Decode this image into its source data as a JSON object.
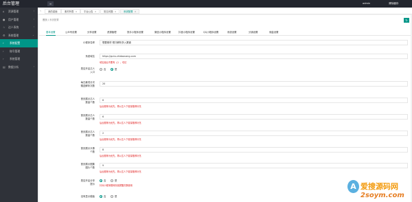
{
  "app": {
    "title": "后台管理",
    "menu_toggle": "≡"
  },
  "header": {
    "admin": "admin",
    "logout": "清除缓存"
  },
  "sidebar": {
    "items": [
      {
        "label": "资源管理",
        "icon": "home-icon"
      },
      {
        "label": "用户管理",
        "icon": "user-icon"
      },
      {
        "label": "达人系统",
        "icon": "star-icon"
      },
      {
        "label": "系统管理",
        "icon": "gear-icon"
      },
      {
        "label": "系统配置",
        "icon": "config-icon"
      },
      {
        "label": "账号管理",
        "icon": "list-icon"
      },
      {
        "label": "系统管理",
        "icon": "list-icon"
      },
      {
        "label": "数据分析",
        "icon": "chart-icon"
      }
    ]
  },
  "tabs": [
    {
      "label": "我的桌面"
    },
    {
      "label": "素材列表"
    },
    {
      "label": "平台公告"
    },
    {
      "label": "常见问题"
    },
    {
      "label": "系统配置"
    }
  ],
  "breadcrumb": {
    "home": "首页",
    "sep": "/",
    "current": "系统配置"
  },
  "subtabs": [
    "基本设置",
    "公众号设置",
    "分享设置",
    "资源管理",
    "快手小程序设置",
    "微信小程序设置",
    "抖音小程序设置",
    "QQ小程序设置",
    "系统设置",
    "分销设置",
    "佣金设置"
  ],
  "form": {
    "app_name": {
      "label": "小程序名称",
      "value": "想要素材·视口解析多入渠道"
    },
    "domain": {
      "label": "系统域名",
      "value": "https://qutu.zhidaovang.com",
      "hint": "域名最后不要有（/），切记"
    },
    "open_entry": {
      "label1": "是否开启达人",
      "label2": "入口",
      "options": [
        "否",
        "是"
      ],
      "selected": 0
    },
    "free_times": {
      "label1": "每日最低分次",
      "label2": "赠送解析次数",
      "value": "20"
    },
    "first_share": {
      "label1": "首页展示达人",
      "label2": "数量个数",
      "value": "6",
      "hint": "后台推荐为优先，再以达人下载量推荐补充"
    },
    "share_count": {
      "label1": "首页展示达人",
      "label2": "数量个数",
      "value": "6",
      "hint": "后台推荐为优先，再以达人下载量推荐补充"
    },
    "rank_count": {
      "label1": "首页展示达人",
      "label2": "数量个数",
      "value": "2",
      "hint": "后台推荐为优先，再以达人下载量推荐补充"
    },
    "avatar_count": {
      "label1": "首页展示头像",
      "label2": "个数",
      "value": "8",
      "hint": "后台推荐为优先，再以达人下载量推荐补充"
    },
    "pic_count": {
      "label1": "首页展示图集",
      "label2": "图片个数",
      "value": "9",
      "hint": "后台推荐为优先，再以达人下载量推荐补充"
    },
    "show_tip": {
      "label1": "是否开启分享",
      "label2": "提示",
      "options": [
        "否",
        "是"
      ],
      "selected": 0,
      "hint": "针对小程序跳转页面提醒次数使用"
    },
    "last_row": {
      "label1": "没有显示模板",
      "options": [
        "否",
        "是"
      ],
      "selected": 0
    }
  },
  "watermark": {
    "title": "爱搜源码网",
    "sub": "2soym.com",
    "badge": "A"
  }
}
